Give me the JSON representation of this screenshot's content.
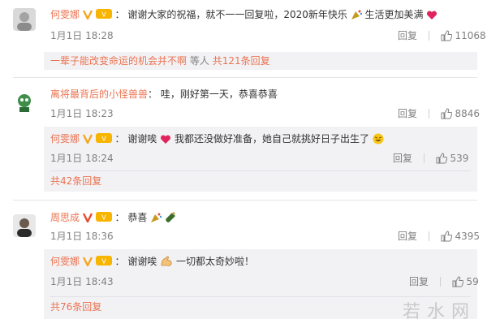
{
  "comments": [
    {
      "name": "何雯娜",
      "text": "谢谢大家的祝福，就不一一回复啦，2020新年快乐",
      "text_tail": "生活更加美满",
      "time": "1月1日 18:28",
      "reply_label": "回复",
      "likes": "11068",
      "more": {
        "prefix": "一辈子能改变命运的机会并不啊",
        "who": "等人",
        "count_link": "共121条回复"
      }
    },
    {
      "name": "离将最背后的小怪兽兽",
      "text": "哇，刚好第一天，恭喜恭喜",
      "time": "1月1日 18:23",
      "reply_label": "回复",
      "likes": "8846",
      "reply": {
        "name": "何雯娜",
        "text_head": "谢谢唉",
        "text": "我都还没做好准备，她自己就挑好日子出生了",
        "time": "1月1日 18:24",
        "reply_label": "回复",
        "likes": "539"
      },
      "more_link": "共42条回复"
    },
    {
      "name": "周思成",
      "text": "恭喜",
      "time": "1月1日 18:36",
      "reply_label": "回复",
      "likes": "4395",
      "reply": {
        "name": "何雯娜",
        "text_head": "谢谢唉",
        "text": "一切都太奇妙啦！",
        "time": "1月1日 18:43",
        "reply_label": "回复",
        "likes": "59"
      },
      "more_link": "共76条回复"
    }
  ],
  "watermark": "若水网",
  "colors": {
    "name": "#eb7350",
    "meta": "#808080",
    "subbg": "#f2f2f5",
    "heart": "#e0245e"
  }
}
